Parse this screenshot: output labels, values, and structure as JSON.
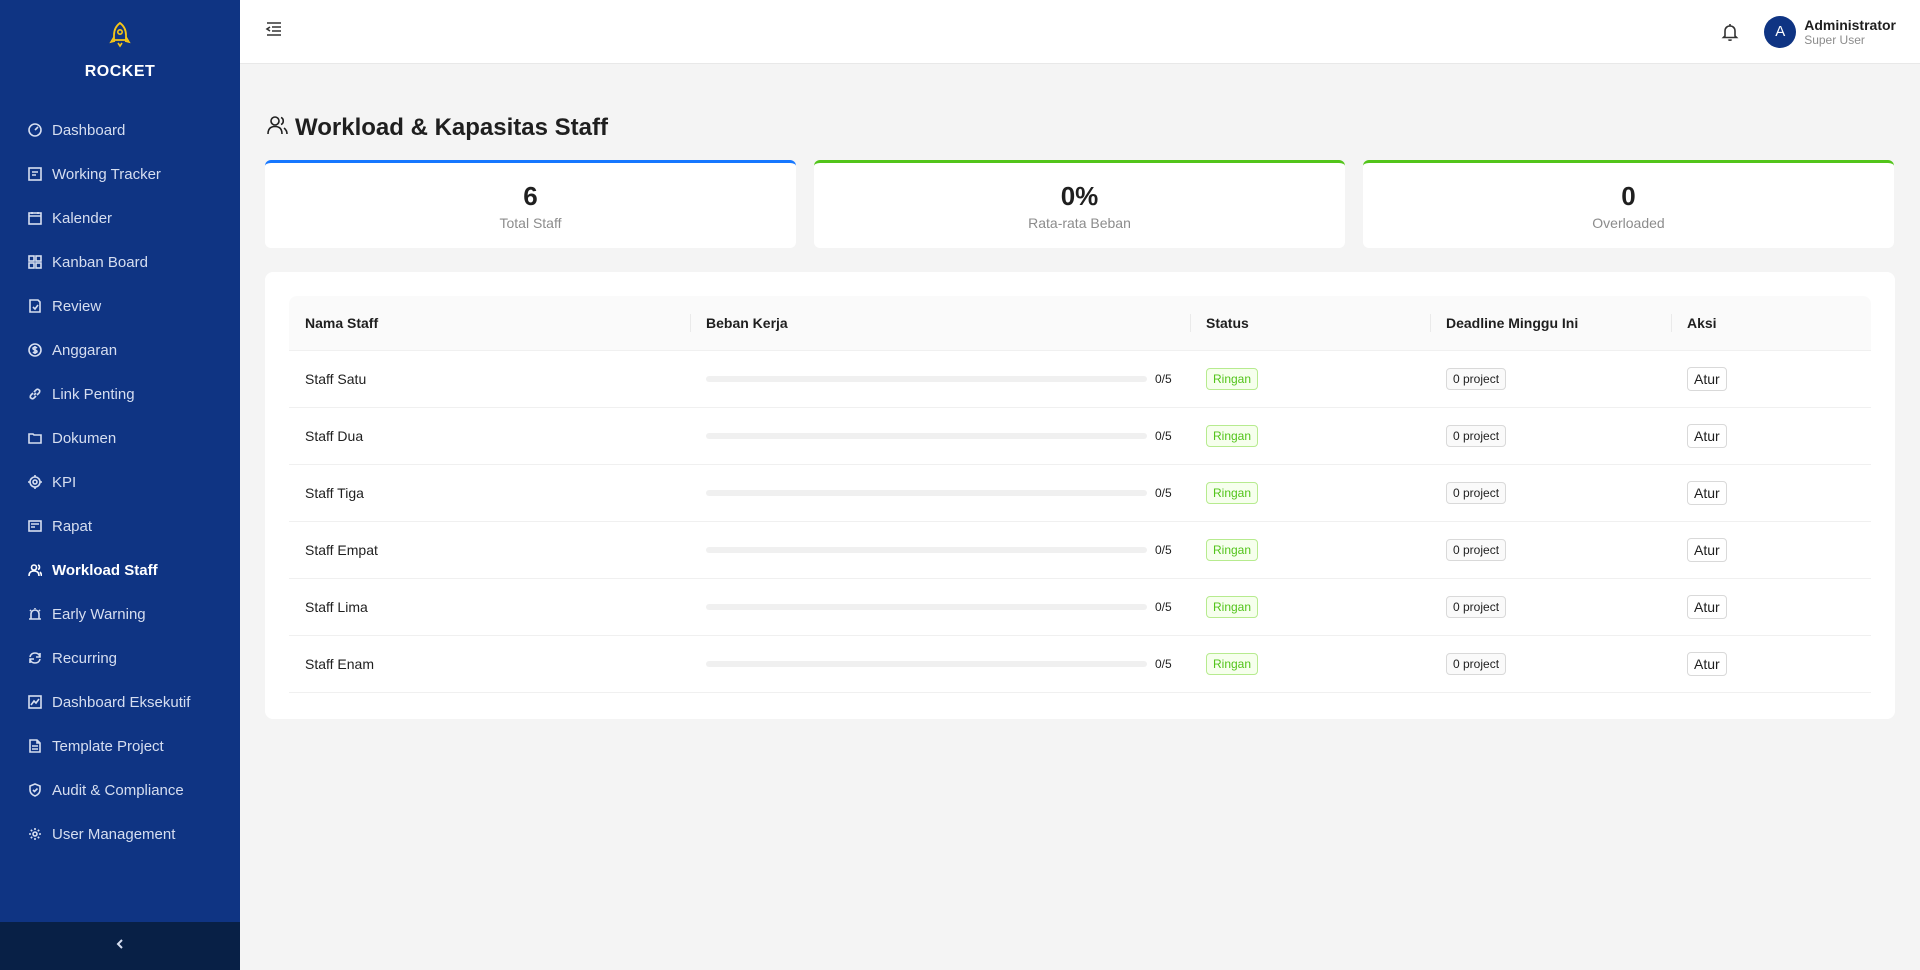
{
  "brand": {
    "name": "ROCKET",
    "icon": "bell-rocket-icon",
    "accent": "#f5c518"
  },
  "colors": {
    "sidebar": "#0f3483",
    "sidebar_footer": "#082046",
    "primary": "#1677ff",
    "success": "#52c41a"
  },
  "sidebar": {
    "items": [
      {
        "label": "Dashboard",
        "icon": "dashboard-icon"
      },
      {
        "label": "Working Tracker",
        "icon": "tracker-icon"
      },
      {
        "label": "Kalender",
        "icon": "calendar-icon"
      },
      {
        "label": "Kanban Board",
        "icon": "kanban-icon"
      },
      {
        "label": "Review",
        "icon": "review-icon"
      },
      {
        "label": "Anggaran",
        "icon": "dollar-icon"
      },
      {
        "label": "Link Penting",
        "icon": "link-icon"
      },
      {
        "label": "Dokumen",
        "icon": "folder-icon"
      },
      {
        "label": "KPI",
        "icon": "target-icon"
      },
      {
        "label": "Rapat",
        "icon": "meeting-icon"
      },
      {
        "label": "Workload Staff",
        "icon": "team-icon",
        "active": true
      },
      {
        "label": "Early Warning",
        "icon": "alarm-icon"
      },
      {
        "label": "Recurring",
        "icon": "refresh-icon"
      },
      {
        "label": "Dashboard Eksekutif",
        "icon": "chart-icon"
      },
      {
        "label": "Template Project",
        "icon": "file-icon"
      },
      {
        "label": "Audit & Compliance",
        "icon": "shield-check-icon"
      },
      {
        "label": "User Management",
        "icon": "gear-icon"
      }
    ]
  },
  "header": {
    "user_initial": "A",
    "user_name": "Administrator",
    "user_role": "Super User"
  },
  "page": {
    "title": "Workload & Kapasitas Staff"
  },
  "stats": [
    {
      "value": "6",
      "label": "Total Staff"
    },
    {
      "value": "0%",
      "label": "Rata-rata Beban"
    },
    {
      "value": "0",
      "label": "Overloaded"
    }
  ],
  "table": {
    "columns": [
      "Nama Staff",
      "Beban Kerja",
      "Status",
      "Deadline Minggu Ini",
      "Aksi"
    ],
    "rows": [
      {
        "name": "Staff Satu",
        "load": "0/5",
        "load_fraction": 0,
        "status": "Ringan",
        "deadline": "0 project",
        "action": "Atur"
      },
      {
        "name": "Staff Dua",
        "load": "0/5",
        "load_fraction": 0,
        "status": "Ringan",
        "deadline": "0 project",
        "action": "Atur"
      },
      {
        "name": "Staff Tiga",
        "load": "0/5",
        "load_fraction": 0,
        "status": "Ringan",
        "deadline": "0 project",
        "action": "Atur"
      },
      {
        "name": "Staff Empat",
        "load": "0/5",
        "load_fraction": 0,
        "status": "Ringan",
        "deadline": "0 project",
        "action": "Atur"
      },
      {
        "name": "Staff Lima",
        "load": "0/5",
        "load_fraction": 0,
        "status": "Ringan",
        "deadline": "0 project",
        "action": "Atur"
      },
      {
        "name": "Staff Enam",
        "load": "0/5",
        "load_fraction": 0,
        "status": "Ringan",
        "deadline": "0 project",
        "action": "Atur"
      }
    ]
  }
}
